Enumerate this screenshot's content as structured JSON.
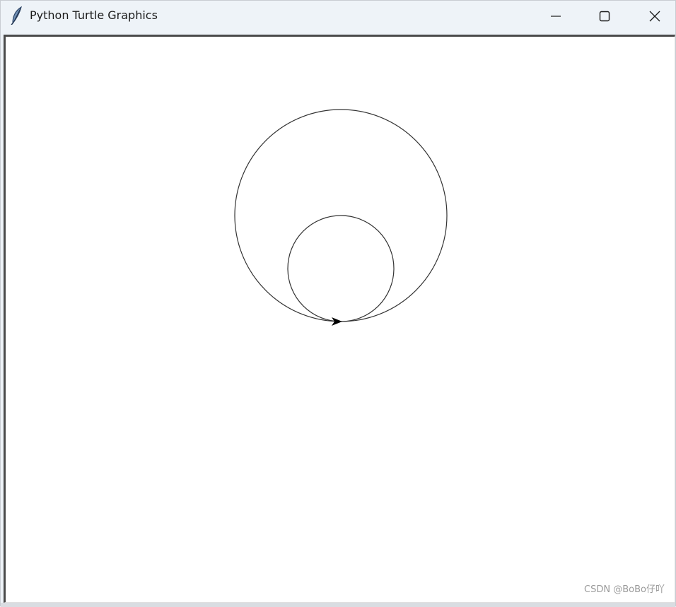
{
  "window": {
    "title": "Python Turtle Graphics",
    "icon": "feather-icon"
  },
  "controls": {
    "minimize_icon": "minimize-icon",
    "maximize_icon": "maximize-icon",
    "close_icon": "close-icon"
  },
  "canvas": {
    "background": "#ffffff",
    "pen_color": "#333333",
    "circles": [
      {
        "name": "large-circle",
        "radius": 150
      },
      {
        "name": "small-circle",
        "radius": 75
      }
    ],
    "turtle": {
      "shape": "arrow",
      "heading": "east"
    }
  },
  "watermark": {
    "text": "CSDN @BoBo仔吖"
  }
}
